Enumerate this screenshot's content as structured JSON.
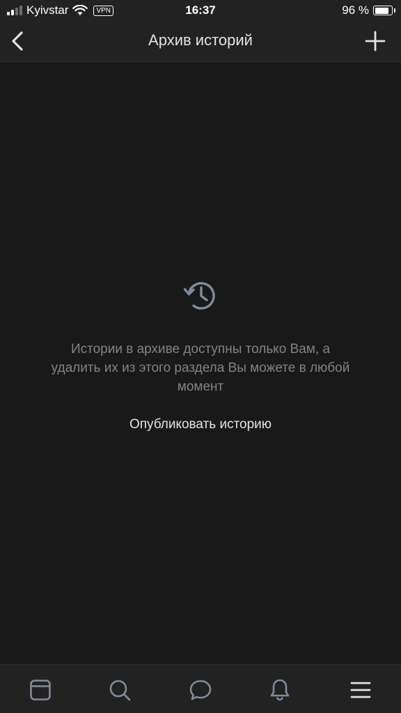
{
  "status_bar": {
    "carrier": "Kyivstar",
    "vpn": "VPN",
    "time": "16:37",
    "battery_text": "96 %",
    "battery_level": 0.96,
    "icons": [
      "signal-icon",
      "wifi-icon",
      "battery-icon"
    ]
  },
  "nav": {
    "title": "Архив историй",
    "back_icon": "chevron-left-icon",
    "add_icon": "plus-icon"
  },
  "empty_state": {
    "icon": "history-icon",
    "message": "Истории в архиве доступны только Вам, а удалить их из этого раздела Вы можете в любой момент",
    "action_label": "Опубликовать историю"
  },
  "tab_bar": {
    "items": [
      {
        "icon": "newsfeed-icon"
      },
      {
        "icon": "search-icon"
      },
      {
        "icon": "messages-icon"
      },
      {
        "icon": "notifications-icon"
      },
      {
        "icon": "menu-icon"
      }
    ]
  },
  "colors": {
    "background": "#19191a",
    "bar_background": "#222222",
    "icon_gray": "#818c99",
    "text_primary": "#e1e3e6",
    "text_secondary": "#828282"
  }
}
